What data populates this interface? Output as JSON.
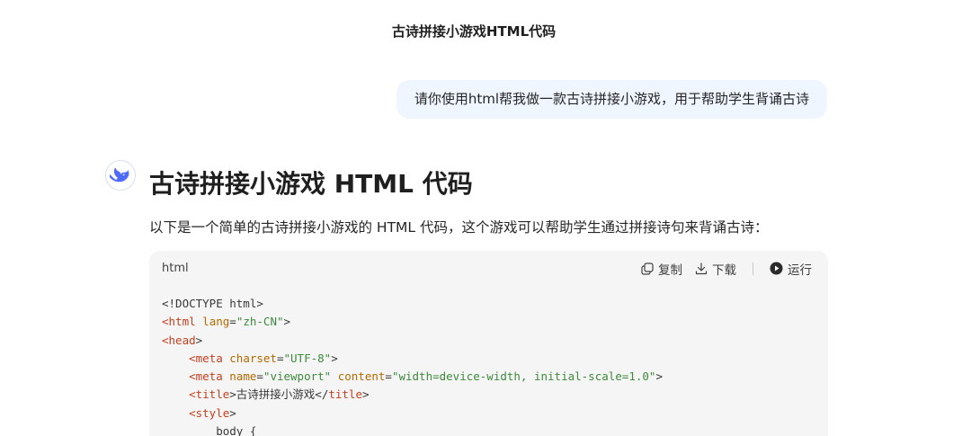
{
  "conversation": {
    "title": "古诗拼接小游戏HTML代码"
  },
  "user_message": {
    "text": "请你使用html帮我做一款古诗拼接小游戏，用于帮助学生背诵古诗"
  },
  "assistant_message": {
    "avatar_icon": "whale-logo-icon",
    "heading": "古诗拼接小游戏 HTML 代码",
    "intro": "以下是一个简单的古诗拼接小游戏的 HTML 代码，这个游戏可以帮助学生通过拼接诗句来背诵古诗："
  },
  "code_block": {
    "language": "html",
    "copy_label": "复制",
    "download_label": "下载",
    "run_label": "运行",
    "lines": [
      [
        {
          "t": "plain",
          "v": "<!DOCTYPE html>"
        }
      ],
      [
        {
          "t": "tag",
          "v": "<html"
        },
        {
          "t": "plain",
          "v": " "
        },
        {
          "t": "attr",
          "v": "lang"
        },
        {
          "t": "plain",
          "v": "="
        },
        {
          "t": "str",
          "v": "\"zh-CN\""
        },
        {
          "t": "plain",
          "v": ">"
        }
      ],
      [
        {
          "t": "tag",
          "v": "<head"
        },
        {
          "t": "plain",
          "v": ">"
        }
      ],
      [
        {
          "t": "plain",
          "v": "    "
        },
        {
          "t": "tag",
          "v": "<meta"
        },
        {
          "t": "plain",
          "v": " "
        },
        {
          "t": "attr",
          "v": "charset"
        },
        {
          "t": "plain",
          "v": "="
        },
        {
          "t": "str",
          "v": "\"UTF-8\""
        },
        {
          "t": "plain",
          "v": ">"
        }
      ],
      [
        {
          "t": "plain",
          "v": "    "
        },
        {
          "t": "tag",
          "v": "<meta"
        },
        {
          "t": "plain",
          "v": " "
        },
        {
          "t": "attr",
          "v": "name"
        },
        {
          "t": "plain",
          "v": "="
        },
        {
          "t": "str",
          "v": "\"viewport\""
        },
        {
          "t": "plain",
          "v": " "
        },
        {
          "t": "attr",
          "v": "content"
        },
        {
          "t": "plain",
          "v": "="
        },
        {
          "t": "str",
          "v": "\"width=device-width, initial-scale=1.0\""
        },
        {
          "t": "plain",
          "v": ">"
        }
      ],
      [
        {
          "t": "plain",
          "v": "    "
        },
        {
          "t": "tag",
          "v": "<title"
        },
        {
          "t": "plain",
          "v": ">古诗拼接小游戏</"
        },
        {
          "t": "tag",
          "v": "title"
        },
        {
          "t": "plain",
          "v": ">"
        }
      ],
      [
        {
          "t": "plain",
          "v": "    "
        },
        {
          "t": "tag",
          "v": "<style"
        },
        {
          "t": "plain",
          "v": ">"
        }
      ],
      [
        {
          "t": "plain",
          "v": "        body {"
        }
      ]
    ]
  }
}
